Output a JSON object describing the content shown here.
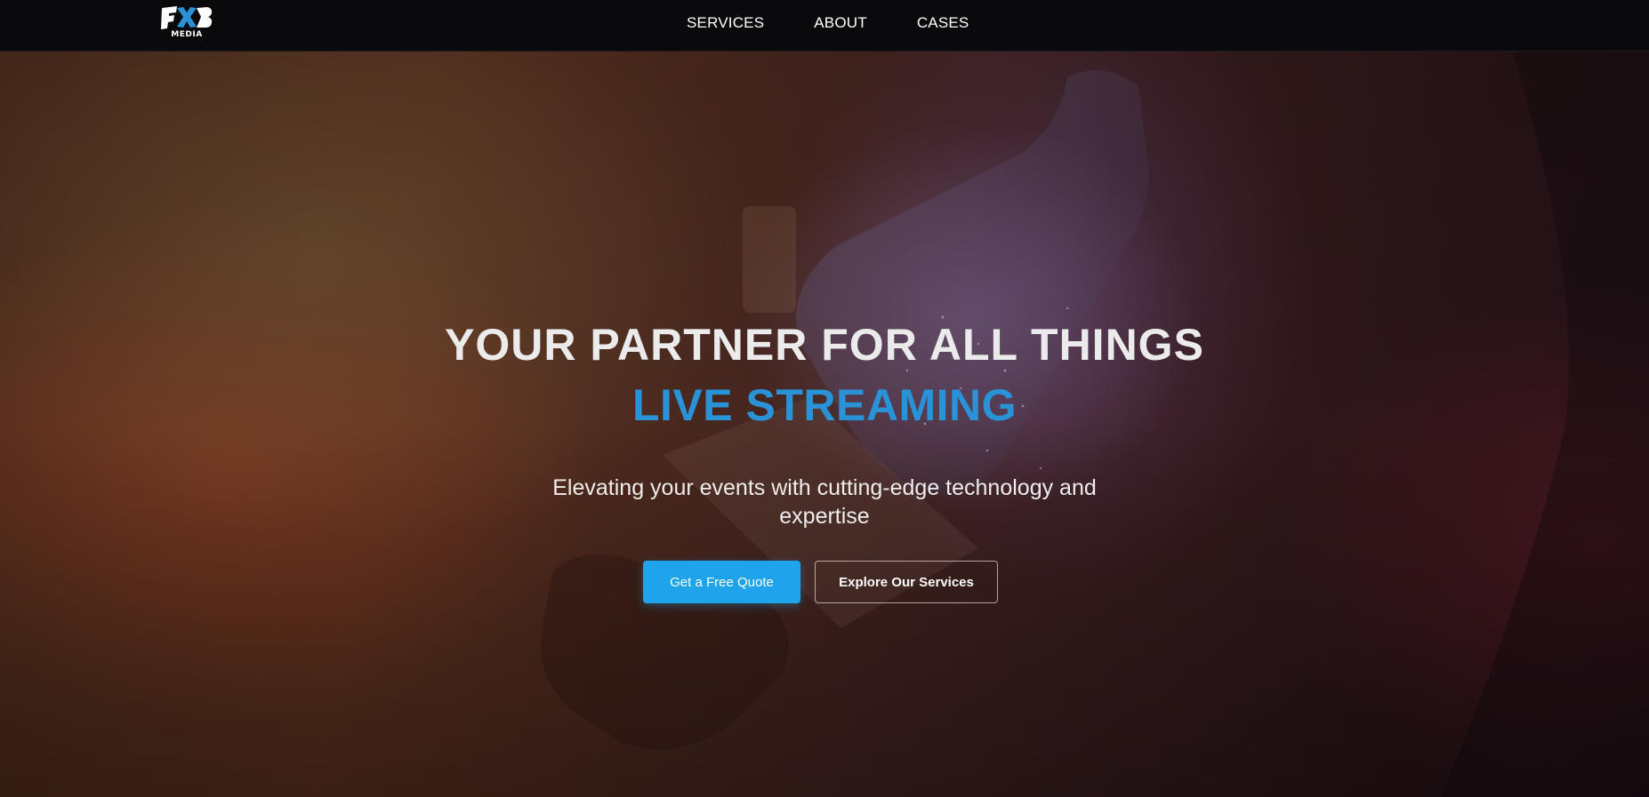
{
  "brand": {
    "logo_sub": "MEDIA",
    "logo_icon": "fxb-logo-icon",
    "accent_color": "#2a93d8",
    "button_color": "#1fa3ea"
  },
  "nav": {
    "items": [
      {
        "label": "SERVICES"
      },
      {
        "label": "ABOUT"
      },
      {
        "label": "CASES"
      }
    ]
  },
  "hero": {
    "headline_line1": "YOUR PARTNER FOR ALL THINGS",
    "headline_line2": "LIVE STREAMING",
    "subtitle": "Elevating your events with cutting-edge technology and expertise",
    "primary_cta": "Get a Free Quote",
    "secondary_cta": "Explore Our Services"
  }
}
